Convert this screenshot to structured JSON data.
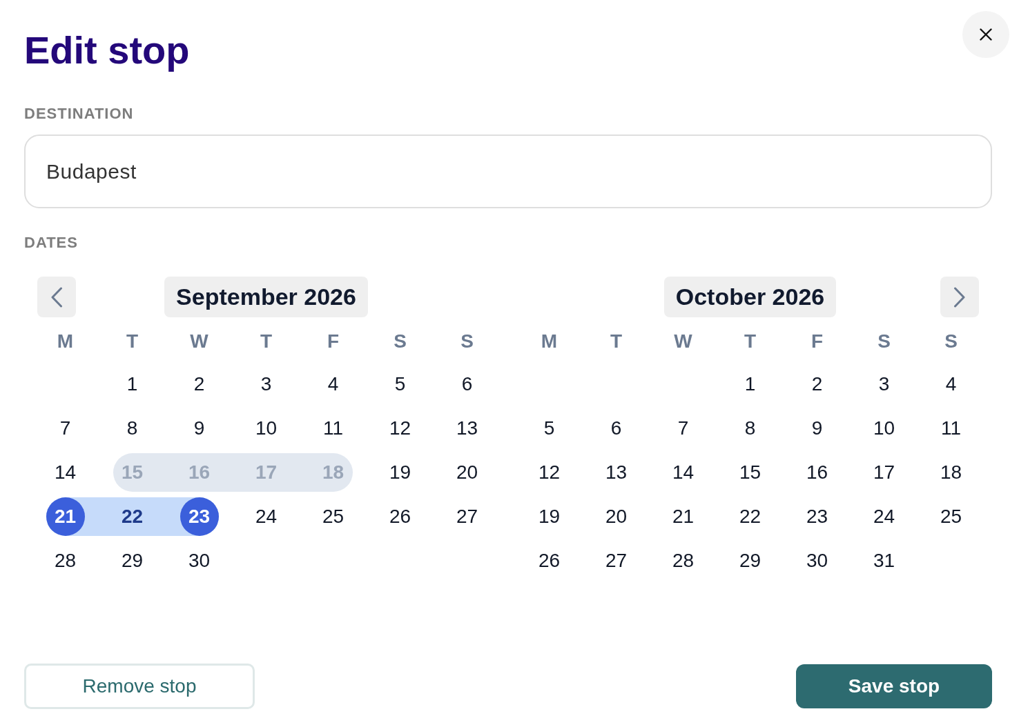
{
  "dialog": {
    "title": "Edit stop"
  },
  "destination": {
    "label": "DESTINATION",
    "value": "Budapest"
  },
  "dates": {
    "label": "DATES",
    "months": [
      {
        "title": "September 2026",
        "weekdays": [
          "M",
          "T",
          "W",
          "T",
          "F",
          "S",
          "S"
        ],
        "days": [
          {
            "kind": "blank"
          },
          {
            "kind": "day",
            "label": "1",
            "selected": false,
            "in_range": false,
            "disabled": false
          },
          {
            "kind": "day",
            "label": "2",
            "selected": false,
            "in_range": false,
            "disabled": false
          },
          {
            "kind": "day",
            "label": "3",
            "selected": false,
            "in_range": false,
            "disabled": false
          },
          {
            "kind": "day",
            "label": "4",
            "selected": false,
            "in_range": false,
            "disabled": false
          },
          {
            "kind": "day",
            "label": "5",
            "selected": false,
            "in_range": false,
            "disabled": false
          },
          {
            "kind": "day",
            "label": "6",
            "selected": false,
            "in_range": false,
            "disabled": false
          },
          {
            "kind": "day",
            "label": "7",
            "selected": false,
            "in_range": false,
            "disabled": false
          },
          {
            "kind": "day",
            "label": "8",
            "selected": false,
            "in_range": false,
            "disabled": false
          },
          {
            "kind": "day",
            "label": "9",
            "selected": false,
            "in_range": false,
            "disabled": false
          },
          {
            "kind": "day",
            "label": "10",
            "selected": false,
            "in_range": false,
            "disabled": false
          },
          {
            "kind": "day",
            "label": "11",
            "selected": false,
            "in_range": false,
            "disabled": false
          },
          {
            "kind": "day",
            "label": "12",
            "selected": false,
            "in_range": false,
            "disabled": false
          },
          {
            "kind": "day",
            "label": "13",
            "selected": false,
            "in_range": false,
            "disabled": false
          },
          {
            "kind": "day",
            "label": "14",
            "selected": false,
            "in_range": false,
            "disabled": false
          },
          {
            "kind": "day",
            "label": "15",
            "selected": false,
            "in_range": false,
            "disabled": true
          },
          {
            "kind": "day",
            "label": "16",
            "selected": false,
            "in_range": false,
            "disabled": true
          },
          {
            "kind": "day",
            "label": "17",
            "selected": false,
            "in_range": false,
            "disabled": true
          },
          {
            "kind": "day",
            "label": "18",
            "selected": false,
            "in_range": false,
            "disabled": true
          },
          {
            "kind": "day",
            "label": "19",
            "selected": false,
            "in_range": false,
            "disabled": false
          },
          {
            "kind": "day",
            "label": "20",
            "selected": false,
            "in_range": false,
            "disabled": false
          },
          {
            "kind": "day",
            "label": "21",
            "selected": true,
            "in_range": true,
            "disabled": false
          },
          {
            "kind": "day",
            "label": "22",
            "selected": false,
            "in_range": true,
            "disabled": false
          },
          {
            "kind": "day",
            "label": "23",
            "selected": true,
            "in_range": true,
            "disabled": false
          },
          {
            "kind": "day",
            "label": "24",
            "selected": false,
            "in_range": false,
            "disabled": false
          },
          {
            "kind": "day",
            "label": "25",
            "selected": false,
            "in_range": false,
            "disabled": false
          },
          {
            "kind": "day",
            "label": "26",
            "selected": false,
            "in_range": false,
            "disabled": false
          },
          {
            "kind": "day",
            "label": "27",
            "selected": false,
            "in_range": false,
            "disabled": false
          },
          {
            "kind": "day",
            "label": "28",
            "selected": false,
            "in_range": false,
            "disabled": false
          },
          {
            "kind": "day",
            "label": "29",
            "selected": false,
            "in_range": false,
            "disabled": false
          },
          {
            "kind": "day",
            "label": "30",
            "selected": false,
            "in_range": false,
            "disabled": false
          }
        ]
      },
      {
        "title": "October 2026",
        "weekdays": [
          "M",
          "T",
          "W",
          "T",
          "F",
          "S",
          "S"
        ],
        "days": [
          {
            "kind": "blank"
          },
          {
            "kind": "blank"
          },
          {
            "kind": "blank"
          },
          {
            "kind": "day",
            "label": "1",
            "selected": false,
            "in_range": false,
            "disabled": false
          },
          {
            "kind": "day",
            "label": "2",
            "selected": false,
            "in_range": false,
            "disabled": false
          },
          {
            "kind": "day",
            "label": "3",
            "selected": false,
            "in_range": false,
            "disabled": false
          },
          {
            "kind": "day",
            "label": "4",
            "selected": false,
            "in_range": false,
            "disabled": false
          },
          {
            "kind": "day",
            "label": "5",
            "selected": false,
            "in_range": false,
            "disabled": false
          },
          {
            "kind": "day",
            "label": "6",
            "selected": false,
            "in_range": false,
            "disabled": false
          },
          {
            "kind": "day",
            "label": "7",
            "selected": false,
            "in_range": false,
            "disabled": false
          },
          {
            "kind": "day",
            "label": "8",
            "selected": false,
            "in_range": false,
            "disabled": false
          },
          {
            "kind": "day",
            "label": "9",
            "selected": false,
            "in_range": false,
            "disabled": false
          },
          {
            "kind": "day",
            "label": "10",
            "selected": false,
            "in_range": false,
            "disabled": false
          },
          {
            "kind": "day",
            "label": "11",
            "selected": false,
            "in_range": false,
            "disabled": false
          },
          {
            "kind": "day",
            "label": "12",
            "selected": false,
            "in_range": false,
            "disabled": false
          },
          {
            "kind": "day",
            "label": "13",
            "selected": false,
            "in_range": false,
            "disabled": false
          },
          {
            "kind": "day",
            "label": "14",
            "selected": false,
            "in_range": false,
            "disabled": false
          },
          {
            "kind": "day",
            "label": "15",
            "selected": false,
            "in_range": false,
            "disabled": false
          },
          {
            "kind": "day",
            "label": "16",
            "selected": false,
            "in_range": false,
            "disabled": false
          },
          {
            "kind": "day",
            "label": "17",
            "selected": false,
            "in_range": false,
            "disabled": false
          },
          {
            "kind": "day",
            "label": "18",
            "selected": false,
            "in_range": false,
            "disabled": false
          },
          {
            "kind": "day",
            "label": "19",
            "selected": false,
            "in_range": false,
            "disabled": false
          },
          {
            "kind": "day",
            "label": "20",
            "selected": false,
            "in_range": false,
            "disabled": false
          },
          {
            "kind": "day",
            "label": "21",
            "selected": false,
            "in_range": false,
            "disabled": false
          },
          {
            "kind": "day",
            "label": "22",
            "selected": false,
            "in_range": false,
            "disabled": false
          },
          {
            "kind": "day",
            "label": "23",
            "selected": false,
            "in_range": false,
            "disabled": false
          },
          {
            "kind": "day",
            "label": "24",
            "selected": false,
            "in_range": false,
            "disabled": false
          },
          {
            "kind": "day",
            "label": "25",
            "selected": false,
            "in_range": false,
            "disabled": false
          },
          {
            "kind": "day",
            "label": "26",
            "selected": false,
            "in_range": false,
            "disabled": false
          },
          {
            "kind": "day",
            "label": "27",
            "selected": false,
            "in_range": false,
            "disabled": false
          },
          {
            "kind": "day",
            "label": "28",
            "selected": false,
            "in_range": false,
            "disabled": false
          },
          {
            "kind": "day",
            "label": "29",
            "selected": false,
            "in_range": false,
            "disabled": false
          },
          {
            "kind": "day",
            "label": "30",
            "selected": false,
            "in_range": false,
            "disabled": false
          },
          {
            "kind": "day",
            "label": "31",
            "selected": false,
            "in_range": false,
            "disabled": false
          }
        ]
      }
    ]
  },
  "buttons": [
    {
      "label": "Remove stop",
      "kind": "secondary"
    },
    {
      "label": "Save stop",
      "kind": "primary"
    }
  ]
}
